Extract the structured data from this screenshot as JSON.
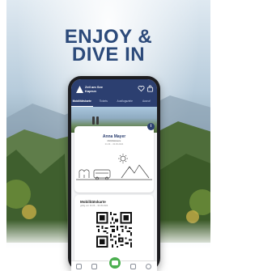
{
  "headline": {
    "line1": "ENJOY &",
    "line2": "DIVE IN"
  },
  "app": {
    "brand_line1": "Zell am See",
    "brand_line2": "Kaprun",
    "header_icons": [
      "heart-icon",
      "shopping-bag-icon"
    ],
    "tabs": [
      {
        "label": "Mobilitätskarte",
        "active": true
      },
      {
        "label": "Tickets",
        "active": false
      },
      {
        "label": "Ausflugsziele",
        "active": false
      },
      {
        "label": "Ausruf",
        "active": false
      }
    ]
  },
  "card_pass": {
    "name": "Anna Mayer",
    "subtitle": "Mobilitätskarte",
    "validity": "01.06. - 30.09.2024",
    "info_badge": "i"
  },
  "card_qr": {
    "title": "Mobilitätskarte",
    "validity": "gültig von 01.06. - 30.09.2024"
  },
  "bottom_nav": [
    "home-icon",
    "ticket-icon",
    "card-icon",
    "map-icon",
    "profile-icon"
  ],
  "colors": {
    "brand_navy": "#2c3f70",
    "headline": "#2c4a7a",
    "accent_green": "#4caf50"
  }
}
